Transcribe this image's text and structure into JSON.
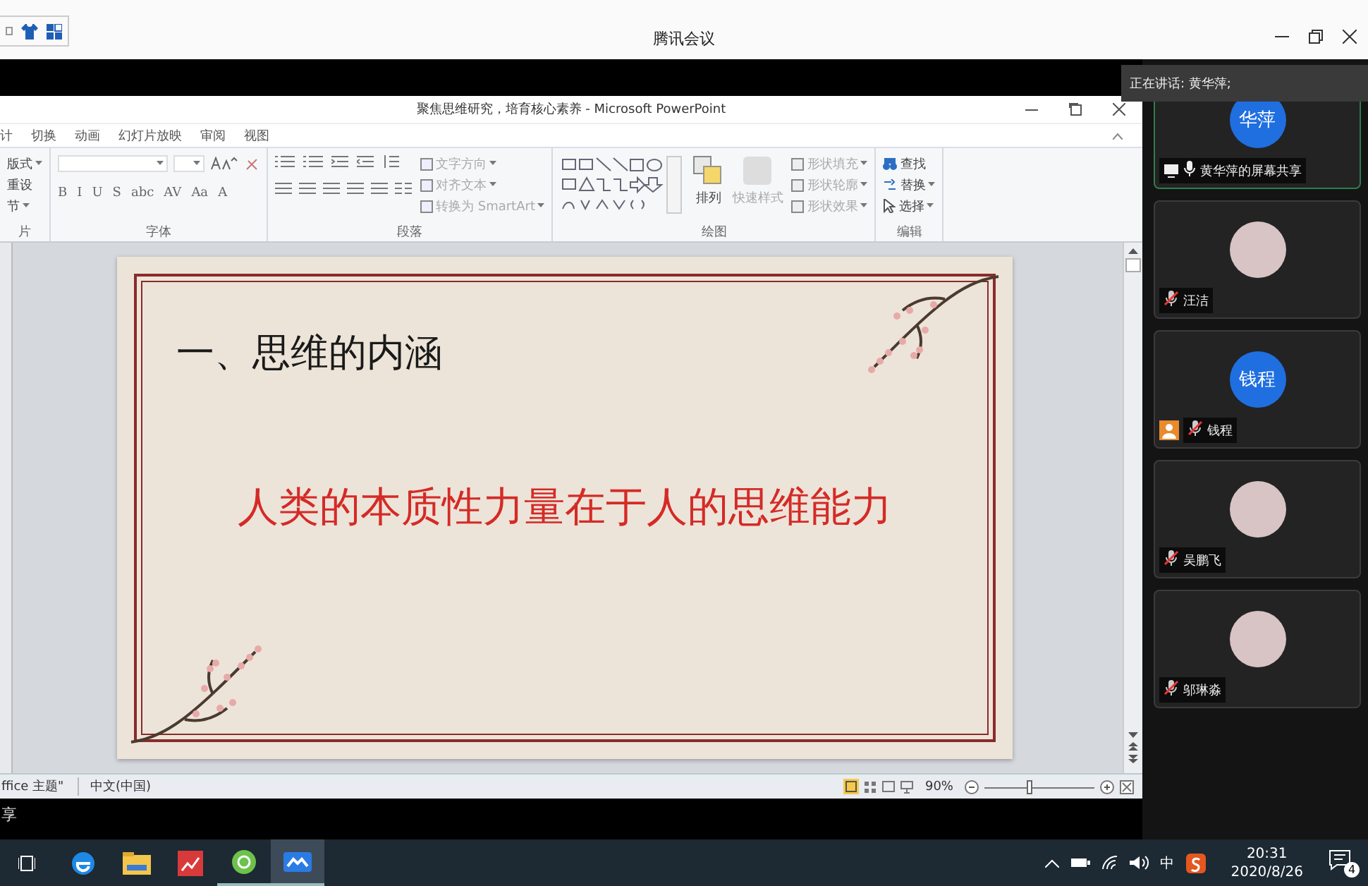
{
  "app": {
    "title": "腾讯会议"
  },
  "presentation": {
    "title": "聚焦思维研究，培育核心素养 - Microsoft PowerPoint",
    "tabs": [
      "计",
      "切换",
      "动画",
      "幻灯片放映",
      "审阅",
      "视图"
    ],
    "ribbon": [
      {
        "kind": "slides",
        "label": "片",
        "buttons": [
          {
            "label": "版式",
            "disabled": false
          },
          {
            "label": "重设",
            "disabled": false
          },
          {
            "label": "节",
            "disabled": false
          }
        ]
      },
      {
        "kind": "font",
        "label": "字体",
        "format_buttons": [
          "B",
          "I",
          "U",
          "S",
          "abc",
          "AV",
          "Aa",
          "A"
        ]
      },
      {
        "kind": "paragraph",
        "label": "段落",
        "buttons": [
          {
            "label": "文字方向",
            "disabled": true
          },
          {
            "label": "对齐文本",
            "disabled": true
          },
          {
            "label": "转换为 SmartArt",
            "disabled": true
          }
        ]
      },
      {
        "kind": "drawing",
        "label": "绘图",
        "large_buttons": [
          {
            "label": "排列",
            "disabled": false
          },
          {
            "label": "快速样式",
            "disabled": true
          }
        ],
        "buttons": [
          {
            "label": "形状填充",
            "disabled": true
          },
          {
            "label": "形状轮廓",
            "disabled": true
          },
          {
            "label": "形状效果",
            "disabled": true
          }
        ]
      },
      {
        "kind": "editing",
        "label": "编辑",
        "buttons": [
          {
            "label": "查找",
            "disabled": false
          },
          {
            "label": "替换",
            "disabled": false
          },
          {
            "label": "选择",
            "disabled": false
          }
        ]
      }
    ],
    "slide": {
      "heading": "一、思维的内涵",
      "statement": "人类的本质性力量在于人的思维能力"
    },
    "status_bar": {
      "theme": "ffice 主题\"",
      "language": "中文(中国)",
      "zoom": "90%",
      "zoom_slider": {
        "level": 0.42
      }
    }
  },
  "caption_fragment": "享",
  "meeting": {
    "speaker_banner": "正在讲话: 黄华萍;",
    "participants": [
      {
        "name": "黄华萍的屏幕共享",
        "kind": "initials",
        "initials": "华萍",
        "selected": true,
        "sharing": true,
        "muted": false,
        "presenter": false
      },
      {
        "name": "汪洁",
        "kind": "photo",
        "selected": false,
        "sharing": false,
        "muted": true,
        "presenter": false
      },
      {
        "name": "钱程",
        "kind": "initials",
        "initials": "钱程",
        "selected": false,
        "sharing": false,
        "muted": true,
        "presenter": true
      },
      {
        "name": "吴鹏飞",
        "kind": "photo",
        "selected": false,
        "sharing": false,
        "muted": true,
        "presenter": false
      },
      {
        "name": "邬琳淼",
        "kind": "photo",
        "selected": false,
        "sharing": false,
        "muted": true,
        "presenter": false
      }
    ]
  },
  "taskbar": {
    "apps": [
      {
        "kind": "browser",
        "selected": false,
        "running": false
      },
      {
        "kind": "folder",
        "selected": false,
        "running": false
      },
      {
        "kind": "presentation",
        "selected": false,
        "running": false
      },
      {
        "kind": "chat",
        "selected": false,
        "running": true
      },
      {
        "kind": "meeting",
        "selected": true,
        "running": true
      }
    ],
    "input_method": "中",
    "time": "20:31",
    "date": "2020/8/26",
    "notifications": "4"
  }
}
